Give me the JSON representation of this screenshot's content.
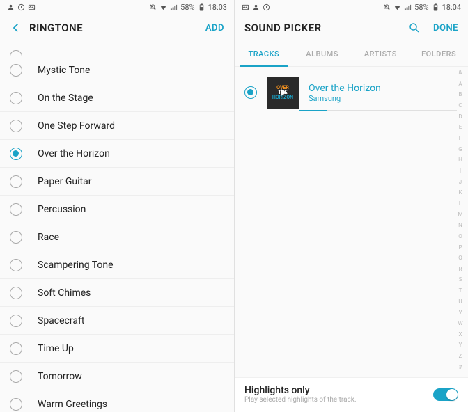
{
  "left": {
    "status": {
      "battery": "58%",
      "time": "18:03"
    },
    "title": "RINGTONE",
    "action": "ADD",
    "selected": "Over the Horizon",
    "items": [
      "Mystic Tone",
      "On the Stage",
      "One Step Forward",
      "Over the Horizon",
      "Paper Guitar",
      "Percussion",
      "Race",
      "Scampering Tone",
      "Soft Chimes",
      "Spacecraft",
      "Time Up",
      "Tomorrow",
      "Warm Greetings"
    ]
  },
  "right": {
    "status": {
      "battery": "58%",
      "time": "18:04"
    },
    "title": "SOUND PICKER",
    "action": "DONE",
    "tabs": [
      "TRACKS",
      "ALBUMS",
      "ARTISTS",
      "FOLDERS"
    ],
    "active_tab": "TRACKS",
    "track": {
      "title": "Over the Horizon",
      "artist": "Samsung"
    },
    "index": [
      "&",
      "A",
      "B",
      "C",
      "D",
      "E",
      "F",
      "G",
      "H",
      "I",
      "J",
      "K",
      "L",
      "M",
      "N",
      "O",
      "P",
      "Q",
      "R",
      "S",
      "T",
      "U",
      "V",
      "W",
      "X",
      "Y",
      "Z",
      "#"
    ],
    "highlights": {
      "title": "Highlights only",
      "sub": "Play selected highlights of the track."
    }
  }
}
